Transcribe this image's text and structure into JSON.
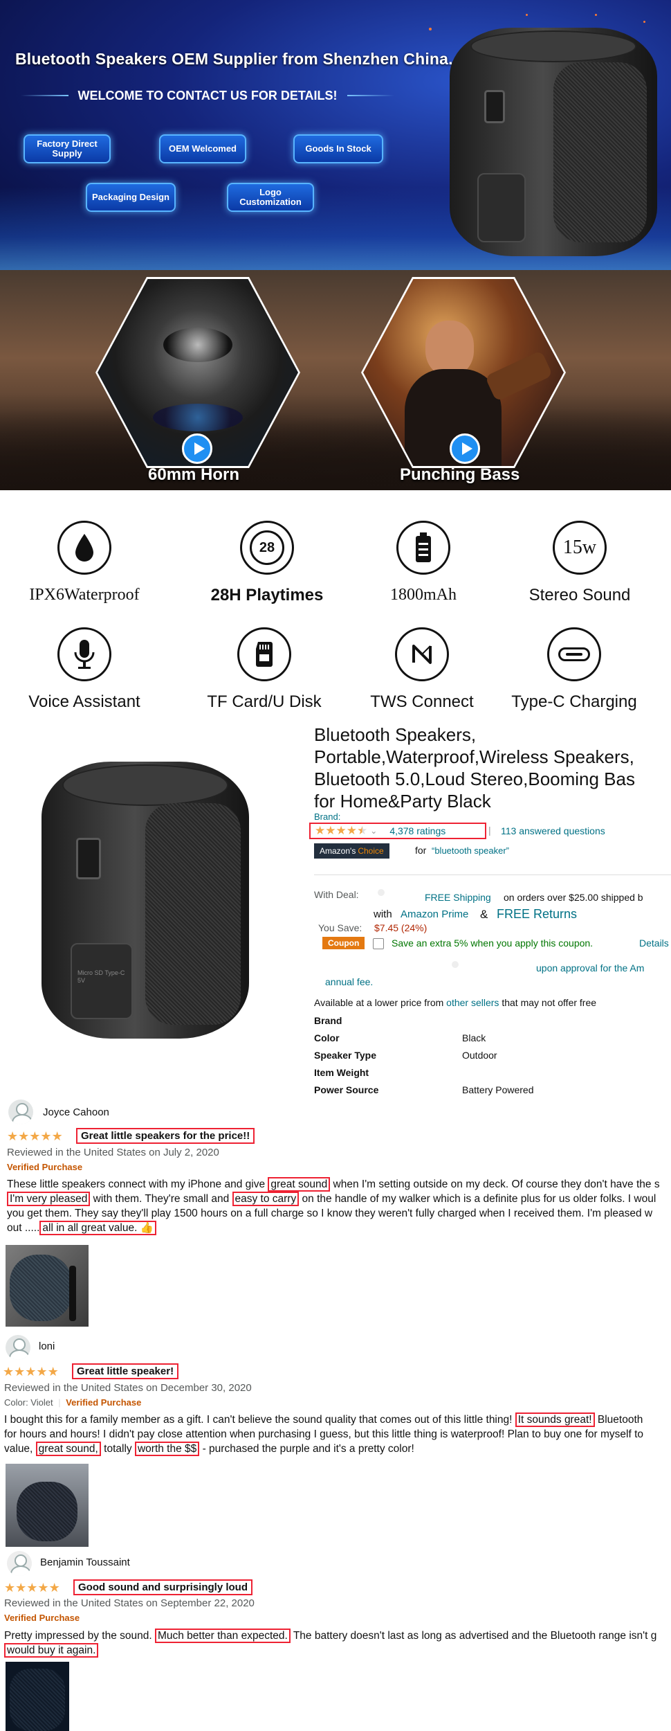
{
  "banner": {
    "title": "Bluetooth Speakers OEM Supplier from Shenzhen China.",
    "subtitle": "WELCOME TO CONTACT US FOR DETAILS!",
    "pills": [
      "Factory Direct Supply",
      "OEM Welcomed",
      "Goods In Stock",
      "Packaging Design",
      "Logo Customization"
    ],
    "speaker_text": "Micro SD  Type-C 5V"
  },
  "strip": {
    "left_label": "60mm Horn",
    "right_label": "Punching Bass"
  },
  "features": [
    {
      "icon": "water-drop-icon",
      "label": "IPX6Waterproof"
    },
    {
      "icon": "28-hour-clock-icon",
      "label": "28H Playtimes",
      "icon_text": "28"
    },
    {
      "icon": "battery-icon",
      "label": "1800mAh"
    },
    {
      "icon": "15w-icon",
      "label": "Stereo Sound",
      "icon_text": "15w"
    },
    {
      "icon": "microphone-icon",
      "label": "Voice Assistant"
    },
    {
      "icon": "sd-card-icon",
      "label": "TF Card/U Disk"
    },
    {
      "icon": "tws-icon",
      "label": "TWS Connect"
    },
    {
      "icon": "usb-c-icon",
      "label": "Type-C Charging"
    }
  ],
  "product": {
    "title_lines": [
      "Bluetooth Speakers,                                        C",
      "Portable,Waterproof,Wireless Speakers,",
      "Bluetooth 5.0,Loud Stereo,Booming Bas",
      "for Home&Party Black"
    ],
    "brand_label": "Brand:",
    "rating": 4.5,
    "rating_caret": "⌄",
    "ratings_count": "4,378 ratings",
    "divider": "|",
    "answered": "113 answered questions",
    "choice_badge_1": "Amazon's",
    "choice_badge_2": "Choice",
    "choice_for": "for",
    "choice_query": "“bluetooth speaker”",
    "with_deal": "With Deal:",
    "free_shipping": "FREE Shipping",
    "shipping_rest": "on orders over $25.00 shipped b",
    "with": "with",
    "prime": "Amazon Prime",
    "amp": "&",
    "free_returns": "FREE Returns",
    "you_save_label": "You Save:",
    "you_save_value": "$7.45 (24%)",
    "coupon_label": "Coupon",
    "coupon_text": "Save an extra 5% when you apply this coupon.",
    "coupon_details": "Details",
    "approval_text": "upon approval for the Am",
    "annual_fee": "annual fee.",
    "lower_price_1": "Available at a lower price from",
    "lower_price_link": "other sellers",
    "lower_price_2": "that may not offer free",
    "specs": [
      {
        "k": "Brand",
        "v": ""
      },
      {
        "k": "Color",
        "v": "Black"
      },
      {
        "k": "Speaker Type",
        "v": "Outdoor"
      },
      {
        "k": "Item Weight",
        "v": ""
      },
      {
        "k": "Power Source",
        "v": "Battery Powered"
      }
    ]
  },
  "reviews": [
    {
      "name": "Joyce Cahoon",
      "rating": 5,
      "title": "Great little speakers for the price!!",
      "meta": "Reviewed in the United States on July 2, 2020",
      "verified": "Verified Purchase",
      "lines": [
        [
          {
            "t": "These little speakers connect with my iPhone and give "
          },
          {
            "t": "great sound",
            "h": true
          },
          {
            "t": " when I'm setting outside on my deck. Of course they don't have the s"
          }
        ],
        [
          {
            "t": "I'm very pleased",
            "h": true
          },
          {
            "t": " with them. They're small and "
          },
          {
            "t": "easy to carry",
            "h": true
          },
          {
            "t": " on the handle of my walker which is a definite plus for us older folks. I woul"
          }
        ],
        [
          {
            "t": "you get them. They say they'll play 1500 hours on a full charge so I know they weren't fully charged when I received them. I'm pleased w"
          }
        ],
        [
          {
            "t": "out ....."
          },
          {
            "t": "all in all great value. 👍",
            "h": true
          }
        ]
      ]
    },
    {
      "name": "loni",
      "rating": 5,
      "title": "Great little speaker!",
      "meta": "Reviewed in the United States on December 30, 2020",
      "color_label": "Color: Violet",
      "verified": "Verified Purchase",
      "lines": [
        [
          {
            "t": "I bought this for a family member as a gift. I can't believe the sound quality that comes out of this little thing! "
          },
          {
            "t": "It sounds great!",
            "h": true
          },
          {
            "t": " Bluetooth "
          }
        ],
        [
          {
            "t": "for hours and hours! I didn't pay close attention when purchasing I guess, but this little thing is waterproof! Plan to buy one for myself to"
          }
        ],
        [
          {
            "t": "value, "
          },
          {
            "t": "great sound,",
            "h": true
          },
          {
            "t": " totally "
          },
          {
            "t": "worth the $$",
            "h": true
          },
          {
            "t": " - purchased the purple and it's a pretty color!"
          }
        ]
      ]
    },
    {
      "name": "Benjamin Toussaint",
      "rating": 5,
      "title": "Good sound and surprisingly loud",
      "meta": "Reviewed in the United States on September 22, 2020",
      "verified": "Verified Purchase",
      "lines": [
        [
          {
            "t": "Pretty impressed by the sound. "
          },
          {
            "t": "Much better than expected.",
            "h": true
          },
          {
            "t": " The battery doesn't last as long as advertised and the Bluetooth range isn't g"
          }
        ],
        [
          {
            "t": "would buy it again.",
            "h": true
          }
        ]
      ]
    }
  ],
  "colors": {
    "accent_link": "#007185",
    "star": "#f3a847",
    "highlight": "#ee2233",
    "verified": "#c45500",
    "coupon": "#e47911"
  }
}
